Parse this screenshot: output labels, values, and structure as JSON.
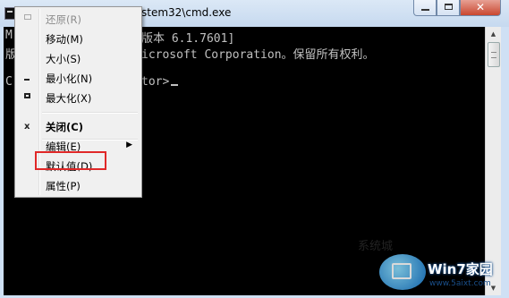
{
  "window": {
    "title": "stem32\\cmd.exe",
    "controls": {
      "minimize": "—",
      "maximize": "□",
      "close": "✕"
    }
  },
  "console": {
    "lines": [
      "M",
      "版",
      "",
      "C"
    ],
    "line1_right": "版本 6.1.7601]",
    "line2_right": "icrosoft Corporation。保留所有权利。",
    "prompt_right": "tor>"
  },
  "context_menu": {
    "items": [
      {
        "label": "还原(R)",
        "icon": "restore-icon",
        "disabled": true
      },
      {
        "label": "移动(M)",
        "icon": "",
        "disabled": false
      },
      {
        "label": "大小(S)",
        "icon": "",
        "disabled": false
      },
      {
        "label": "最小化(N)",
        "icon": "minimize-icon",
        "disabled": false
      },
      {
        "label": "最大化(X)",
        "icon": "maximize-icon",
        "disabled": false
      },
      {
        "label": "关闭(C)",
        "icon": "close-icon",
        "disabled": false,
        "bold": true
      },
      {
        "label": "编辑(E)",
        "icon": "",
        "disabled": false,
        "submenu": true
      },
      {
        "label": "默认值(D)",
        "icon": "",
        "disabled": false,
        "highlighted": true
      },
      {
        "label": "属性(P)",
        "icon": "",
        "disabled": false
      }
    ],
    "highlight_color": "#e02828"
  },
  "watermark": {
    "brand": "Win7家园",
    "url": "www.5aixt.com",
    "faint_text": "系统城"
  },
  "colors": {
    "console_bg": "#000000",
    "console_text": "#c0c0c0",
    "menu_bg": "#f0f0f0"
  }
}
